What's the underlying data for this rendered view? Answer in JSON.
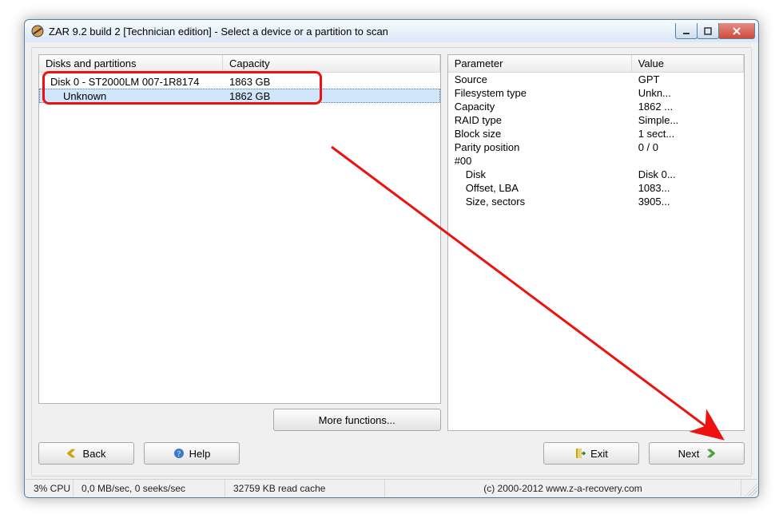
{
  "window": {
    "title": "ZAR 9.2 build 2 [Technician edition] - Select a device or a partition to scan"
  },
  "left": {
    "headers": {
      "disk": "Disks and partitions",
      "capacity": "Capacity"
    },
    "rows": [
      {
        "label": "Disk 0 - ST2000LM 007-1R8174",
        "capacity": "1863 GB",
        "indent": 1,
        "selected": false
      },
      {
        "label": "Unknown",
        "capacity": "1862 GB",
        "indent": 2,
        "selected": true
      }
    ],
    "more_functions": "More functions..."
  },
  "right": {
    "headers": {
      "param": "Parameter",
      "value": "Value"
    },
    "rows": [
      {
        "param": "Source",
        "value": "GPT",
        "indent": 0
      },
      {
        "param": "Filesystem type",
        "value": "Unkn...",
        "indent": 0
      },
      {
        "param": "Capacity",
        "value": "1862 ...",
        "indent": 0
      },
      {
        "param": "RAID type",
        "value": "Simple...",
        "indent": 0
      },
      {
        "param": "Block size",
        "value": "1 sect...",
        "indent": 0
      },
      {
        "param": "Parity position",
        "value": "0 / 0",
        "indent": 0
      },
      {
        "param": "#00",
        "value": "",
        "indent": 0
      },
      {
        "param": "Disk",
        "value": "Disk 0...",
        "indent": 1
      },
      {
        "param": "Offset, LBA",
        "value": "1083...",
        "indent": 1
      },
      {
        "param": "Size, sectors",
        "value": "3905...",
        "indent": 1
      }
    ]
  },
  "buttons": {
    "back": "Back",
    "help": "Help",
    "exit": "Exit",
    "next": "Next"
  },
  "status": {
    "cpu": "3% CPU",
    "io": "0,0 MB/sec, 0 seeks/sec",
    "cache": "32759 KB read cache",
    "copyright": "(c) 2000-2012 www.z-a-recovery.com"
  }
}
